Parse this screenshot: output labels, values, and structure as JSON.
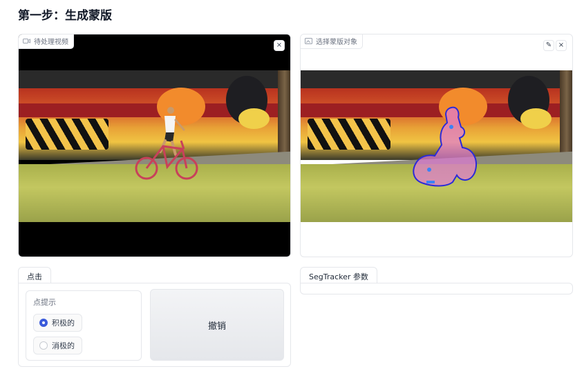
{
  "page": {
    "title": "第一步：生成蒙版"
  },
  "video_panel": {
    "label": "待处理视频",
    "close_icon": "×"
  },
  "mask_panel": {
    "label": "选择蒙版对象",
    "edit_icon": "✎",
    "close_icon": "×"
  },
  "click_tab": {
    "tab_label": "点击",
    "prompt_group": {
      "label": "点提示",
      "options": [
        {
          "label": "积极的",
          "selected": true
        },
        {
          "label": "消极的",
          "selected": false
        }
      ]
    },
    "undo_label": "撤销"
  },
  "segtracker_tab": {
    "tab_label": "SegTracker 参数"
  },
  "colors": {
    "accent": "#3b5bdb",
    "mask_fill": "#e07ad6",
    "mask_outline": "#2b2ad8"
  }
}
